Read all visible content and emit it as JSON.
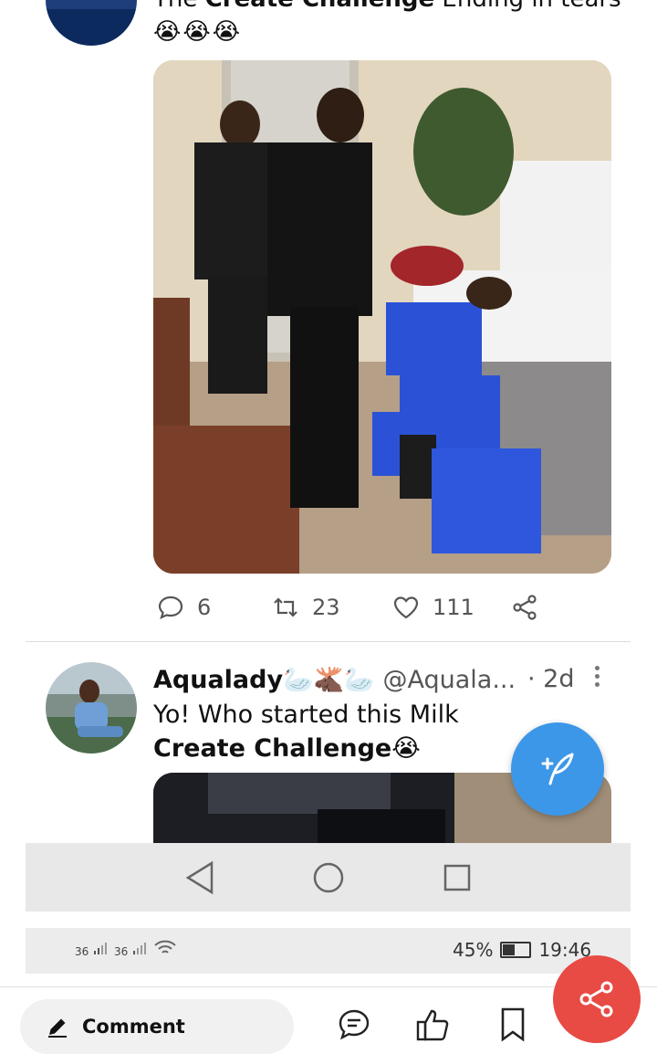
{
  "tweet1": {
    "text_prefix": "The ",
    "text_bold": "Create Challenge",
    "text_suffix": " Ending in tears",
    "emojis": "😭😭😭",
    "actions": {
      "replies": "6",
      "retweets": "23",
      "likes": "111"
    }
  },
  "tweet2": {
    "name": "Aqualady🦢🫎🦢",
    "handle": "@Aquala...",
    "time": "· 2d",
    "body_prefix": "Yo! Who started this Milk ",
    "body_bold": "Create Challenge",
    "body_emoji": "😭"
  },
  "statusbar": {
    "signal1": "36",
    "signal2": "36",
    "battery": "45%",
    "time": "19:46"
  },
  "bottom": {
    "comment_label": "Comment"
  },
  "colors": {
    "fab": "#3d97e8",
    "share_fab": "#e84a44"
  },
  "icons": {
    "reply": "reply-icon",
    "retweet": "retweet-icon",
    "like": "heart-icon",
    "share": "share-icon",
    "compose": "compose-icon",
    "nav_back": "back-triangle-icon",
    "nav_home": "home-circle-icon",
    "nav_recents": "recents-square-icon"
  }
}
